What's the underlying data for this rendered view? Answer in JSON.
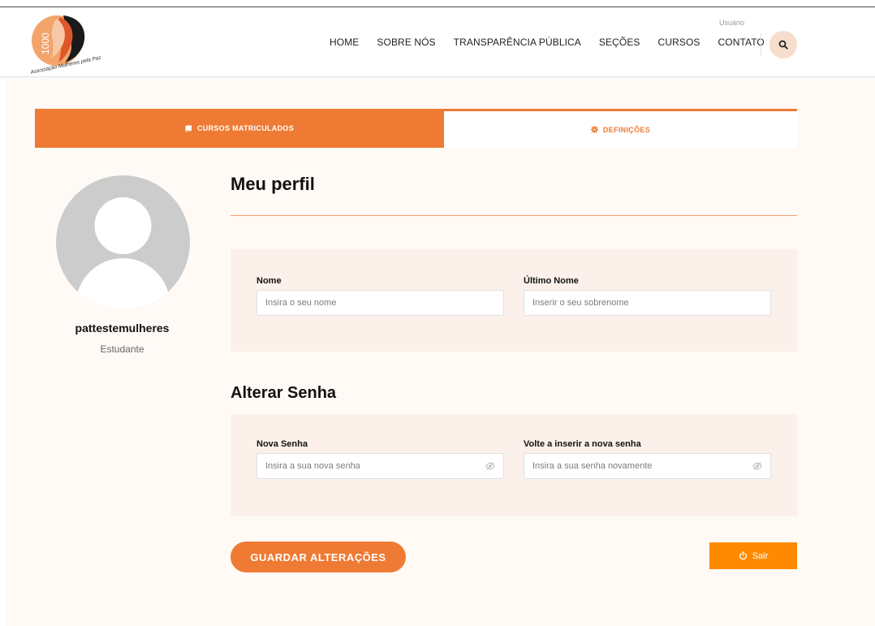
{
  "header": {
    "user_label": "Usuário",
    "logo_text": "Associação Mulheres pela Paz",
    "logo_number": "1000",
    "nav": [
      "HOME",
      "SOBRE NÓS",
      "TRANSPARÊNCIA PÚBLICA",
      "SEÇÕES",
      "CURSOS",
      "CONTATO"
    ]
  },
  "tabs": {
    "enrolled": "CURSOS MATRICULADOS",
    "settings": "DEFINIÇÕES"
  },
  "profile": {
    "username": "pattestemulheres",
    "role": "Estudante"
  },
  "form": {
    "title": "Meu perfil",
    "first_name_label": "Nome",
    "first_name_placeholder": "Insira o seu nome",
    "last_name_label": "Último Nome",
    "last_name_placeholder": "Inserir o seu sobrenome",
    "password_title": "Alterar Senha",
    "new_password_label": "Nova Senha",
    "new_password_placeholder": "Insira a sua nova senha",
    "confirm_password_label": "Volte a inserir a nova senha",
    "confirm_password_placeholder": "Insira a sua senha novamente",
    "save_label": "GUARDAR ALTERAÇÕES",
    "logout_label": "Sair"
  },
  "colors": {
    "accent": "#ef7a33",
    "logout": "#ff8a00",
    "panel": "#fcf1ea",
    "page_bg": "#fffaf5"
  },
  "icons": {
    "search": "search-icon",
    "book": "book-icon",
    "gear": "gear-icon",
    "eye_off": "eye-off-icon",
    "power": "power-icon",
    "avatar": "user-avatar-icon"
  }
}
